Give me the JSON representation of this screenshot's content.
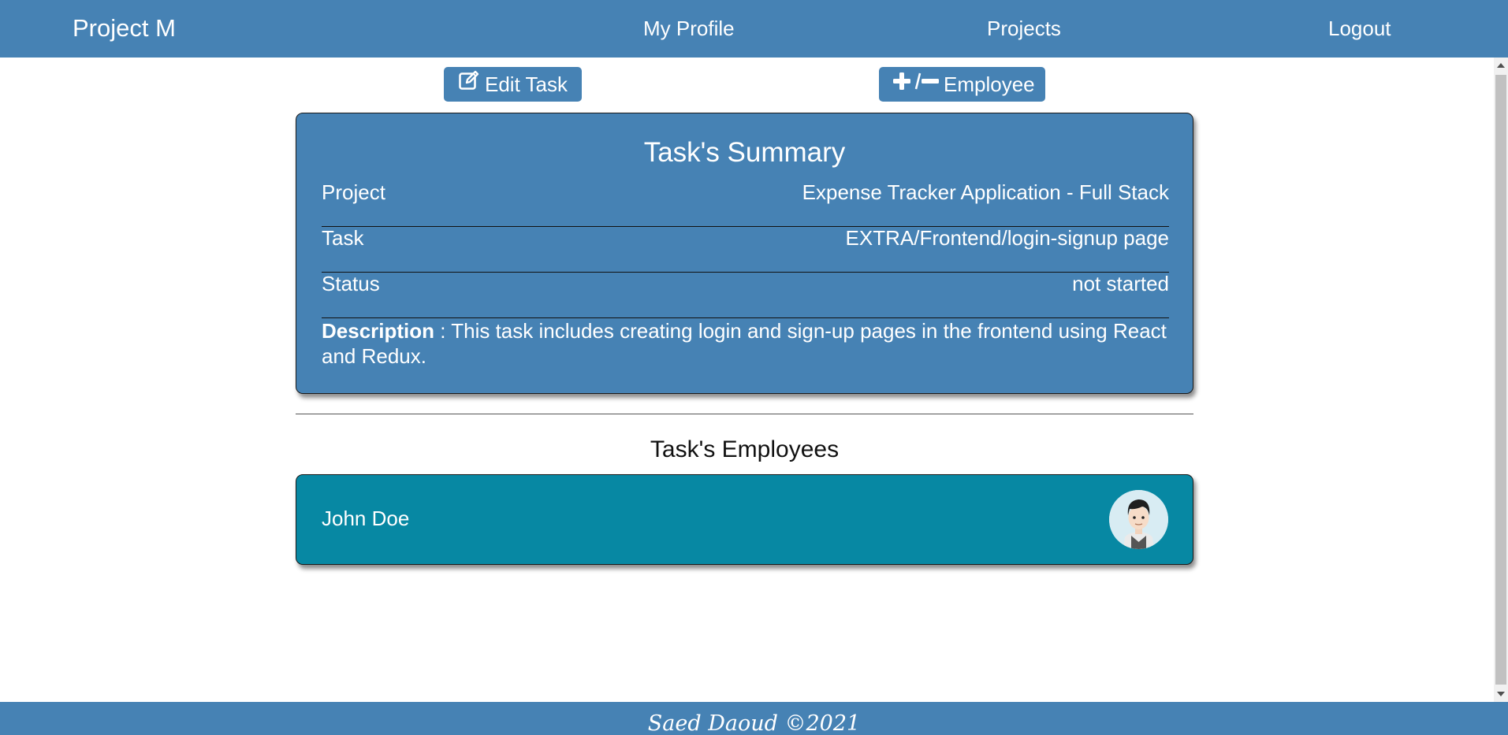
{
  "navbar": {
    "brand": "Project M",
    "links": {
      "profile": "My Profile",
      "projects": "Projects",
      "logout": "Logout"
    }
  },
  "actions": {
    "edit_task": "Edit Task",
    "employee": "Employee"
  },
  "summary": {
    "title": "Task's Summary",
    "rows": [
      {
        "label": "Project",
        "value": "Expense Tracker Application - Full Stack"
      },
      {
        "label": "Task",
        "value": "EXTRA/Frontend/login-signup page"
      },
      {
        "label": "Status",
        "value": "not started"
      }
    ],
    "description_label": "Description",
    "description_text": " : This task includes creating login and sign-up pages in the frontend using React and Redux."
  },
  "employees": {
    "title": "Task's Employees",
    "list": [
      {
        "name": "John Doe"
      }
    ]
  },
  "footer": {
    "text": "Saed Daoud ©2021"
  },
  "colors": {
    "primary": "#4682b4",
    "employee_card": "#0788a3"
  }
}
